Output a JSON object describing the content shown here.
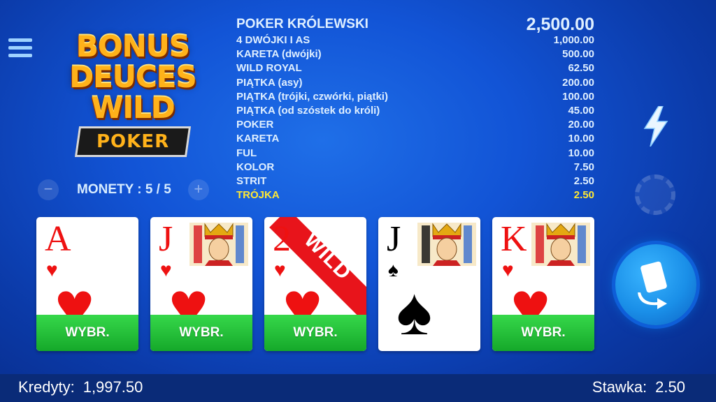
{
  "logo": {
    "line1": "BONUS",
    "line2": "DEUCES",
    "line3": "WILD",
    "band": "POKER"
  },
  "coins": {
    "label": "MONETY : 5 / 5",
    "minus": "−",
    "plus": "+"
  },
  "paytable": [
    {
      "hand": "POKER KRÓLEWSKI",
      "payout": "2,500.00"
    },
    {
      "hand": "4 DWÓJKI I AS",
      "payout": "1,000.00"
    },
    {
      "hand": "KARETA (dwójki)",
      "payout": "500.00"
    },
    {
      "hand": "WILD ROYAL",
      "payout": "62.50"
    },
    {
      "hand": "PIĄTKA (asy)",
      "payout": "200.00"
    },
    {
      "hand": "PIĄTKA (trójki, czwórki, piątki)",
      "payout": "100.00"
    },
    {
      "hand": "PIĄTKA (od szóstek do króli)",
      "payout": "45.00"
    },
    {
      "hand": "POKER",
      "payout": "20.00"
    },
    {
      "hand": "KARETA",
      "payout": "10.00"
    },
    {
      "hand": "FUL",
      "payout": "10.00"
    },
    {
      "hand": "KOLOR",
      "payout": "7.50"
    },
    {
      "hand": "STRIT",
      "payout": "2.50"
    },
    {
      "hand": "TRÓJKA",
      "payout": "2.50"
    }
  ],
  "highlight_row": 12,
  "cards": [
    {
      "rank": "A",
      "suit": "♥",
      "color": "red",
      "held": true,
      "face": false,
      "wild": false
    },
    {
      "rank": "J",
      "suit": "♥",
      "color": "red",
      "held": true,
      "face": true,
      "wild": false
    },
    {
      "rank": "2",
      "suit": "♥",
      "color": "red",
      "held": true,
      "face": false,
      "wild": true
    },
    {
      "rank": "J",
      "suit": "♠",
      "color": "black",
      "held": false,
      "face": true,
      "wild": false
    },
    {
      "rank": "K",
      "suit": "♥",
      "color": "red",
      "held": true,
      "face": true,
      "wild": false
    }
  ],
  "held_label": "WYBR.",
  "wild_label": "WILD",
  "footer": {
    "credits_label": "Kredyty:",
    "credits_value": "1,997.50",
    "stake_label": "Stawka:",
    "stake_value": "2.50"
  },
  "icons": {
    "menu": "hamburger-menu-icon",
    "turbo": "lightning-bolt-icon",
    "chip": "chip-icon",
    "deal": "draw-cards-icon"
  },
  "colors": {
    "held_green": "#22c23a",
    "highlight_yellow": "#ffe833",
    "accent_blue": "#1a8fe8"
  }
}
